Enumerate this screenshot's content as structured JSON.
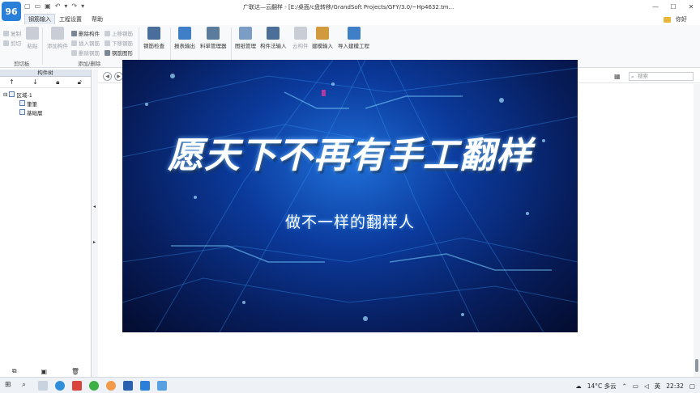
{
  "app": {
    "logo": "96",
    "title": "广联达—云翻样 - [E:/桌面/c盘转移/GrandSoft Projects/GFY/3.0/~Hp4632.tm..."
  },
  "menu": {
    "tabs": [
      "钢筋输入",
      "工程设置",
      "帮助"
    ],
    "user": "你好"
  },
  "ribbon": {
    "clipboard": {
      "copy": "复制",
      "cut": "剪切",
      "paste": "粘贴",
      "group": "剪切板"
    },
    "add_delete": {
      "add_component": "添加构件",
      "delete_component": "删除构件",
      "insert_rebar": "插入钢筋",
      "delete_rebar": "删除钢筋",
      "move_up": "上移钢筋",
      "move_down": "下移钢筋",
      "rebar_shape": "钢筋图形",
      "group": "添加/删除"
    },
    "tools": [
      {
        "label": "钢筋检查",
        "dim": false
      },
      {
        "label": "报表输出",
        "dim": false
      },
      {
        "label": "料单管理器",
        "dim": false
      },
      {
        "label": "图纸管理",
        "dim": false
      },
      {
        "label": "构件法输入",
        "dim": false
      },
      {
        "label": "云构件",
        "dim": true
      },
      {
        "label": "建模输入",
        "dim": false
      },
      {
        "label": "导入建模工程",
        "dim": false
      }
    ]
  },
  "left_panel": {
    "header": "构件树",
    "tree": {
      "root": "区域-1",
      "children": [
        "筆筆",
        "基础層"
      ]
    }
  },
  "work": {
    "search_placeholder": "搜索"
  },
  "video": {
    "headline": "愿天下不再有手工翻样",
    "subline": "做不一样的翻样人"
  },
  "taskbar": {
    "weather": "14°C 多云",
    "ime": "英",
    "time": "22:32"
  },
  "colors": {
    "accent": "#2a7fd8",
    "video_bg": "#0b3a9c"
  }
}
